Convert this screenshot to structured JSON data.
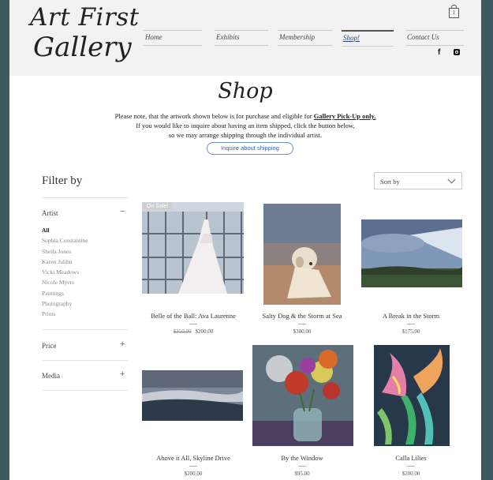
{
  "header": {
    "logo_line1": "Art First",
    "logo_line2": "Gallery",
    "nav": [
      "Home",
      "Exhibits",
      "Membership",
      "Shop!",
      "Contact Us"
    ],
    "active_nav": "Shop!",
    "cart_count": "1",
    "social": {
      "facebook": "f"
    }
  },
  "shop": {
    "title": "Shop",
    "notice_part1": "Please note, that the artwork shown below is for purchase and eligible for ",
    "notice_link": "Gallery Pick-Up only.",
    "notice_line2": "If you would like to inquire about having an item shipped, click the button below,",
    "notice_line3": "so we may arrange shipping through the individual artist.",
    "button": "Inquire about shipping"
  },
  "filter": {
    "title": "Filter by",
    "artist_label": "Artist",
    "artist_sign": "−",
    "artists": [
      "All",
      "Sophia Constantine",
      "Sheila Jones",
      "Karen Julihn",
      "Vicki Meadows",
      "Nicole Myers",
      "Paintings",
      "Photography",
      "Prints"
    ],
    "price_label": "Price",
    "media_label": "Media",
    "plus": "+"
  },
  "sort": {
    "label": "Sort by"
  },
  "products": [
    {
      "name": "Belle of the Ball: Ava Laurenne",
      "old_price": "$250.00",
      "price": "$200.00",
      "badge": "On Sale!"
    },
    {
      "name": "Salty Dog & the Storm at Sea",
      "price": "$300.00"
    },
    {
      "name": "A Break in the Storm",
      "price": "$175.00"
    },
    {
      "name": "Above it All, Skyline Drive",
      "price": "$200.00"
    },
    {
      "name": "By the Window",
      "price": "$95.00"
    },
    {
      "name": "Calla Lilies",
      "price": "$200.00"
    }
  ]
}
